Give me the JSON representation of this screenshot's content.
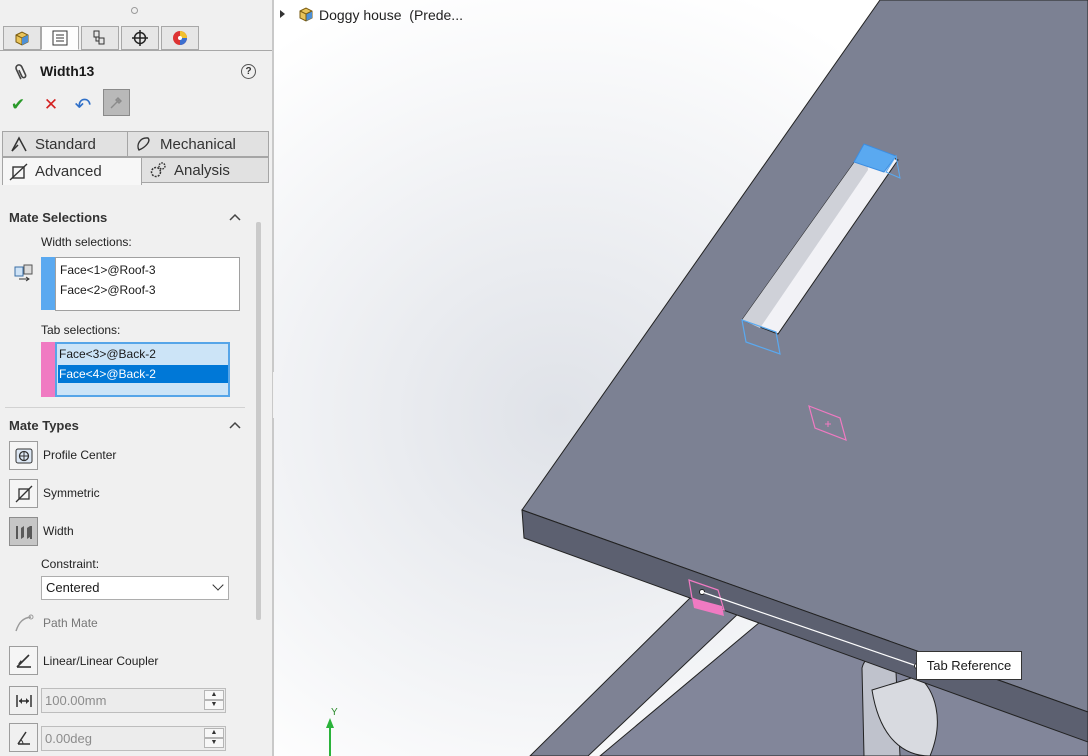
{
  "panel": {
    "title": "Width13",
    "help_glyph": "?",
    "manager_tabs": [
      "feature-manager",
      "property-manager",
      "configuration-manager",
      "dimxpert-manager",
      "display-manager"
    ],
    "commands": {
      "ok": "✔",
      "cancel": "✕",
      "undo": "↶"
    },
    "category_tabs": {
      "standard": "Standard",
      "mechanical": "Mechanical",
      "advanced": "Advanced",
      "analysis": "Analysis"
    },
    "mate_selections": {
      "heading": "Mate Selections",
      "width_label": "Width selections:",
      "width_items": [
        "Face<1>@Roof-3",
        "Face<2>@Roof-3"
      ],
      "tab_label": "Tab selections:",
      "tab_items": [
        "Face<3>@Back-2",
        "Face<4>@Back-2"
      ]
    },
    "mate_types": {
      "heading": "Mate Types",
      "profile_center": "Profile Center",
      "symmetric": "Symmetric",
      "width": "Width",
      "constraint_label": "Constraint:",
      "constraint_value": "Centered",
      "path_mate": "Path Mate",
      "linear_coupler": "Linear/Linear Coupler",
      "distance_value": "100.00mm",
      "angle_value": "0.00deg"
    }
  },
  "viewport": {
    "tree_root": "Doggy house  (Prede...",
    "tooltip": "Tab Reference",
    "axis_label": "Y"
  },
  "colors": {
    "width_marker": "#5aa9f0",
    "tab_marker": "#f07ac2",
    "selection_highlight": "#0078d7",
    "selection_light": "#cce4f7",
    "model_face": "#7c8193"
  }
}
